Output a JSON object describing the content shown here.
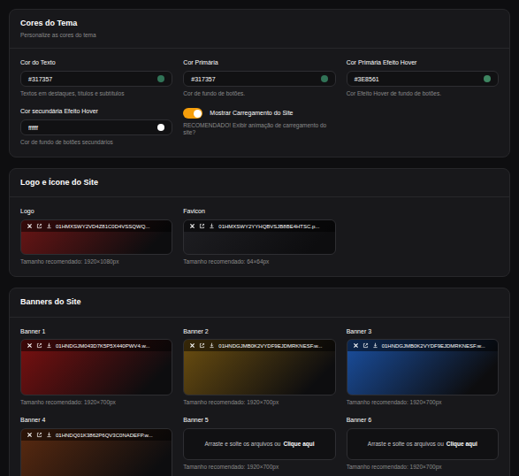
{
  "theme": {
    "title": "Cores do Tema",
    "subtitle": "Personalize as cores do tema",
    "fields": [
      {
        "label": "Cor do Texto",
        "value": "#317357",
        "helper": "Textos em destaques, títulos e subtítulos",
        "color": "#317357"
      },
      {
        "label": "Cor Primária",
        "value": "#317357",
        "helper": "Cor de fundo de botões.",
        "color": "#317357"
      },
      {
        "label": "Cor Primária Efeito Hover",
        "value": "#3E8561",
        "helper": "Cor Efeito Hover de fundo de botões.",
        "color": "#3E8561"
      },
      {
        "label": "Cor secundária Efeito Hover",
        "value": "ffffff",
        "helper": "Cor de fundo de botões secundários",
        "color": "#ffffff"
      }
    ],
    "toggle": {
      "label": "Mostrar Carregamento do Site",
      "helper": "RECOMENDADO! Exibir animação de carregamento do site?",
      "on": true
    }
  },
  "logos": {
    "title": "Logo e Ícone do Site",
    "items": [
      {
        "label": "Logo",
        "file": "01HMXSWY2VD4Z81C0D4VSSQWQ...",
        "helper": "Tamanho recomendado: 1920×1080px",
        "color": "#6a1515"
      },
      {
        "label": "Favicon",
        "file": "01HMXSWY2YYHQBVSJB8BE4HTSC.p...",
        "helper": "Tamanho recomendado: 64×64px",
        "color": "#1e1e22"
      }
    ]
  },
  "banners": {
    "title": "Banners do Site",
    "items": [
      {
        "label": "Banner 1",
        "kind": "file",
        "file": "01HNDGJM043D7K5P5X440PWV4.w...",
        "helper": "Tamanho recomendado: 1920×700px",
        "color": "#7a1010"
      },
      {
        "label": "Banner 2",
        "kind": "file",
        "file": "01HNDGJMB0K2VYDF9EJDMRKNESF.w...",
        "helper": "Tamanho recomendado: 1920×700px",
        "color": "#6b4e10"
      },
      {
        "label": "Banner 3",
        "kind": "file",
        "file": "01HNDGJMB0K2VYDF9EJDMRKNESF.w...",
        "helper": "Tamanho recomendado: 1920×700px",
        "color": "#1a4fa0"
      },
      {
        "label": "Banner 4",
        "kind": "file",
        "file": "01HNDQ01K3862P6QV3C0NADEFP.w...",
        "color": "#5a2a10"
      },
      {
        "label": "Banner 5",
        "kind": "empty",
        "drop_text": "Arraste e solte os arquivos ou",
        "drop_link": "Clique aqui",
        "helper": "Tamanho recomendado: 1920×700px"
      },
      {
        "label": "Banner 6",
        "kind": "empty",
        "drop_text": "Arraste e solte os arquivos ou",
        "drop_link": "Clique aqui",
        "helper": "Tamanho recomendado: 1920×700px"
      }
    ]
  }
}
